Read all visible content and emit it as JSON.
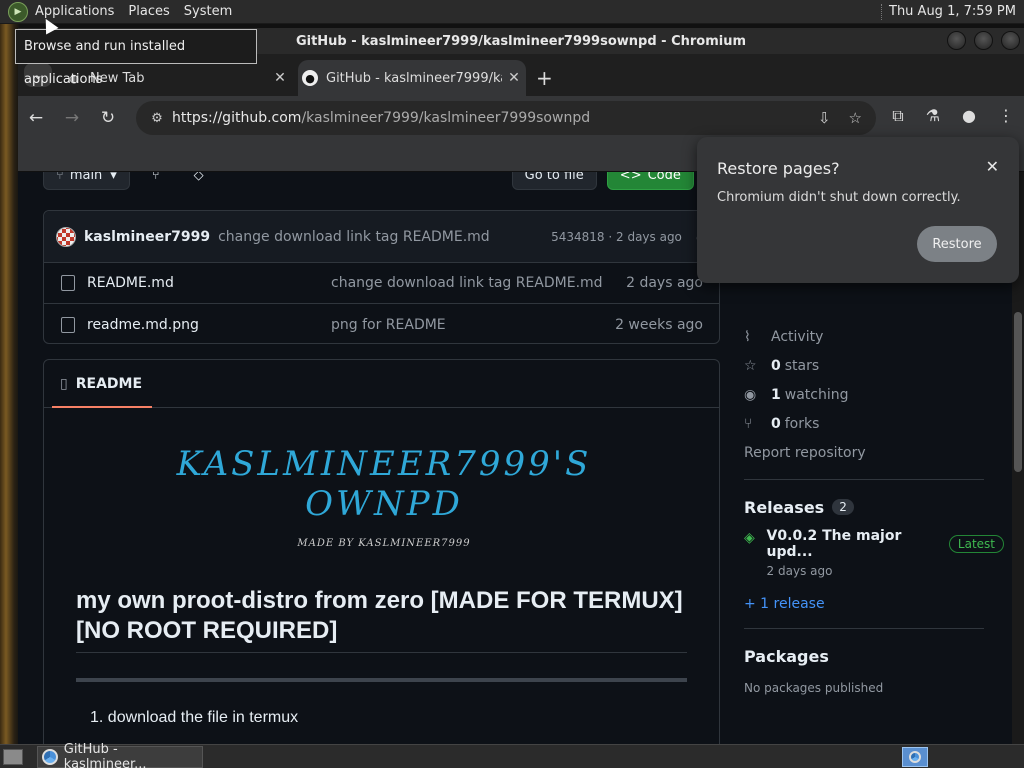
{
  "top_panel": {
    "menus": [
      "Applications",
      "Places",
      "System"
    ],
    "clock": "Thu Aug  1,  7:59 PM",
    "tooltip": "Browse and run installed applications"
  },
  "window": {
    "title": "GitHub - kaslmineer7999/kaslmineer7999sownpd - Chromium"
  },
  "tabs": [
    {
      "label": "New Tab",
      "active": false,
      "icon": "globe-icon"
    },
    {
      "label": "GitHub - kaslmineer7999/ka",
      "active": true,
      "icon": "github-icon"
    }
  ],
  "omnibox": {
    "url_host": "https://github.com",
    "url_path": "/kaslmineer7999/kaslmineer7999sownpd"
  },
  "page": {
    "branch": "main",
    "go_to_file": "Go to file",
    "code_label": "Code",
    "latest_commit": {
      "user": "kaslmineer7999",
      "message": "change download link tag README.md",
      "meta": "5434818 · 2 days ago"
    },
    "files": [
      {
        "name": "README.md",
        "message": "change download link tag README.md",
        "time": "2 days ago"
      },
      {
        "name": "readme.md.png",
        "message": "png for README",
        "time": "2 weeks ago"
      }
    ],
    "readme": {
      "tab_label": "README",
      "logo_text": "KASLMINEER7999'S OWNPD",
      "logo_sub": "MADE BY KASLMINEER7999",
      "heading": "my own proot-distro from zero [MADE FOR TERMUX] [NO ROOT REQUIRED]",
      "list_item_1": "download the file in termux"
    },
    "sidebar": {
      "activity": "Activity",
      "stars_count": "0",
      "stars_label": "stars",
      "watching_count": "1",
      "watching_label": "watching",
      "forks_count": "0",
      "forks_label": "forks",
      "report": "Report repository",
      "releases_heading": "Releases",
      "releases_count": "2",
      "release_title": "V0.0.2 The major upd...",
      "release_badge": "Latest",
      "release_date": "2 days ago",
      "more_releases": "+ 1 release",
      "packages_heading": "Packages",
      "packages_empty": "No packages published"
    }
  },
  "restore_popup": {
    "title": "Restore pages?",
    "message": "Chromium didn't shut down correctly.",
    "button": "Restore"
  },
  "taskbar": {
    "window_button": "GitHub - kaslmineer..."
  },
  "colors": {
    "github_bg": "#0d1117",
    "accent_green": "#238636",
    "link_blue": "#4493f8",
    "readme_underline": "#f78166"
  }
}
